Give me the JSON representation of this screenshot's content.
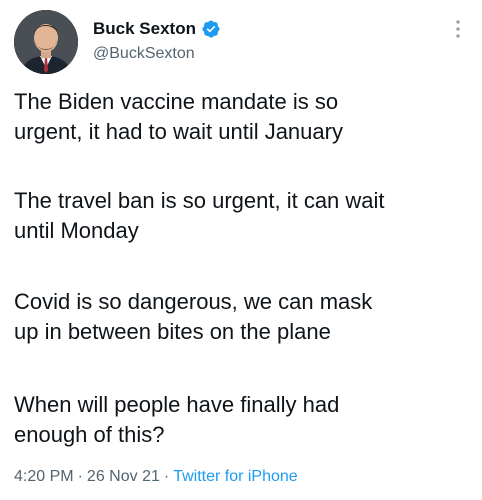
{
  "author": {
    "display_name": "Buck Sexton",
    "handle": "@BuckSexton",
    "verified_icon": "verified-badge-icon",
    "avatar_icon": "profile-photo"
  },
  "tweet": {
    "lines": [
      "The Biden vaccine mandate is so",
      "urgent, it had to wait until January",
      "The travel ban is so urgent, it can wait",
      "until Monday",
      "Covid is so dangerous, we can mask",
      "up in between bites on the plane",
      "When will people have finally had",
      "enough of this?"
    ]
  },
  "meta": {
    "time": "4:20 PM",
    "separator": "·",
    "date": "26 Nov 21",
    "source": "Twitter for iPhone"
  },
  "menu": {
    "icon": "more-vertical-icon"
  },
  "colors": {
    "text": "#0f1419",
    "muted": "#536471",
    "accent": "#1d9bf0"
  }
}
